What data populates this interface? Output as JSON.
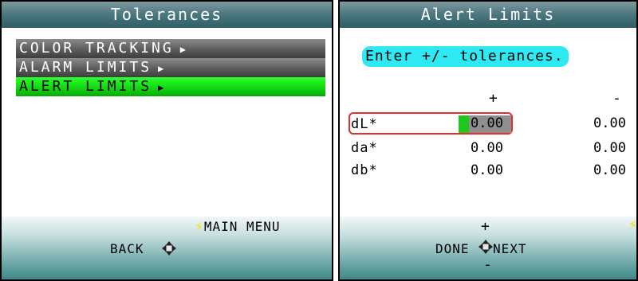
{
  "left": {
    "title": "Tolerances",
    "menu": [
      {
        "label": "COLOR TRACKING",
        "arrow": "▶",
        "state": "normal"
      },
      {
        "label": "ALARM LIMITS",
        "arrow": "▶",
        "state": "normal"
      },
      {
        "label": "ALERT LIMITS",
        "arrow": "▶",
        "state": "selected"
      }
    ],
    "main_menu_label": "MAIN MENU",
    "back_label": "BACK"
  },
  "right": {
    "title": "Alert Limits",
    "prompt": "Enter +/- tolerances.",
    "col_plus": "+",
    "col_minus": "-",
    "rows": [
      {
        "label": "dL*",
        "plus": "0.00",
        "minus": "0.00"
      },
      {
        "label": "da*",
        "plus": "0.00",
        "minus": "0.00"
      },
      {
        "label": "db*",
        "plus": "0.00",
        "minus": "0.00"
      }
    ],
    "done_label": "DONE",
    "next_label": "NEXT",
    "up_label": "+",
    "down_label": "-"
  },
  "icons": {
    "bolt": "⚡",
    "dpad": "dpad-icon"
  },
  "colors": {
    "title_bar": "#4f7980",
    "selected_item": "#12d812",
    "menu_item": "#5c5c5c",
    "prompt_bg": "#2ee9f2",
    "selection_outline": "#e03030",
    "bolt": "#f4e300"
  }
}
